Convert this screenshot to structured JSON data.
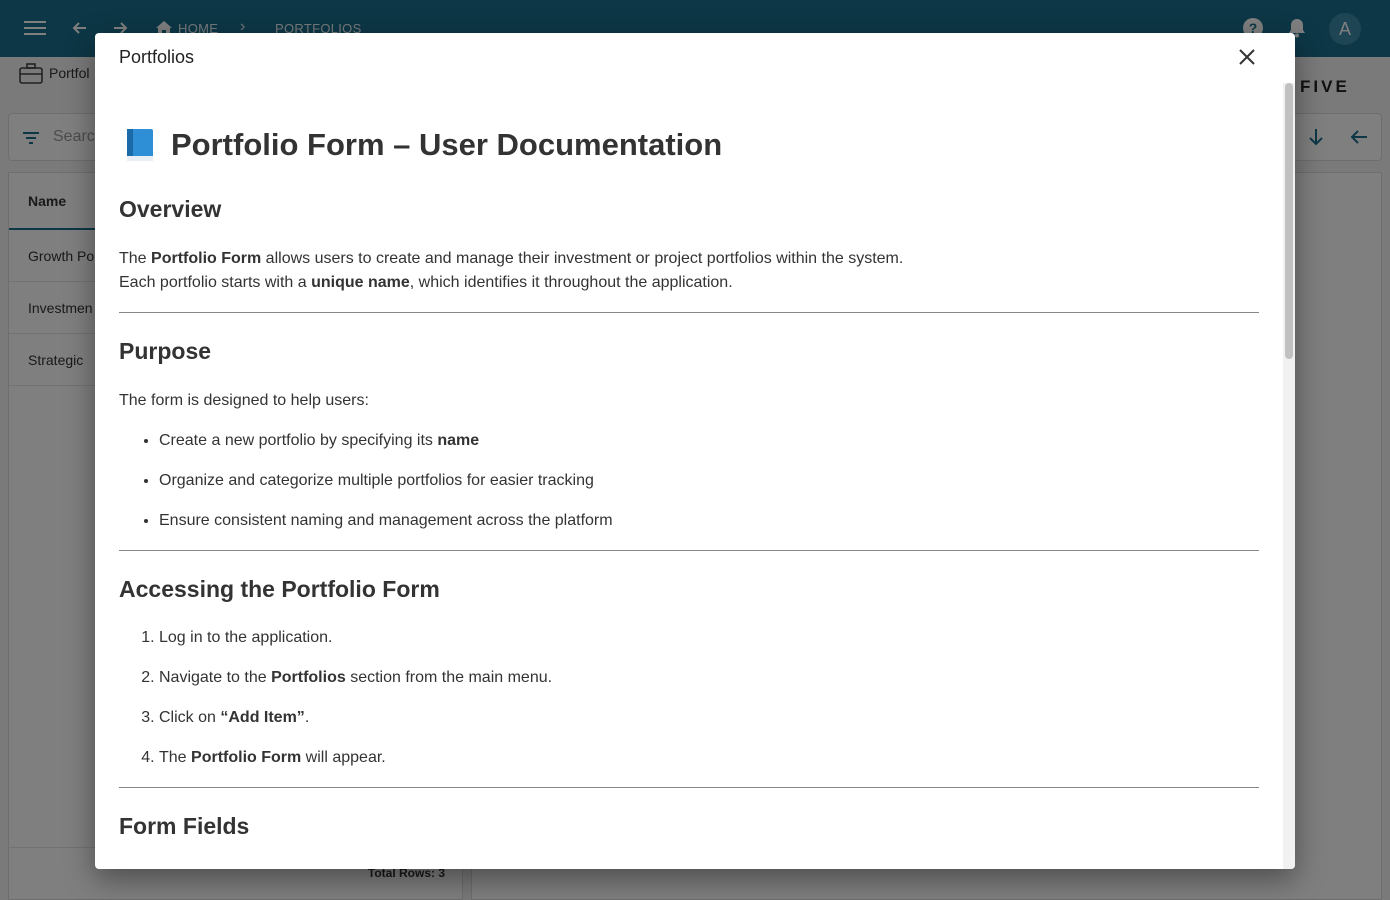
{
  "topbar": {
    "crumb_home": "HOME",
    "crumb_sep": "›",
    "crumb_portfolios": "PORTFOLIOS",
    "avatar_letter": "A",
    "color": "#1b6f8c"
  },
  "subbar": {
    "title": "Portfol",
    "logo": "FIVE"
  },
  "search": {
    "placeholder": "Search"
  },
  "list": {
    "header": "Name",
    "rows": [
      "Growth Po",
      "Investmen",
      "Strategic"
    ],
    "total": "Total Rows: 3"
  },
  "modal": {
    "title": "Portfolios",
    "doc": {
      "h1": "Portfolio Form – User Documentation",
      "overview": {
        "heading": "Overview",
        "line1": [
          "The ",
          "Portfolio Form",
          " allows users to create and manage their investment or project portfolios within the system."
        ],
        "line2": [
          "Each portfolio starts with a ",
          "unique name",
          ", which identifies it throughout the application."
        ]
      },
      "purpose": {
        "heading": "Purpose",
        "intro": "The form is designed to help users:",
        "items": [
          [
            "Create a new portfolio by specifying its ",
            "name",
            ""
          ],
          [
            "Organize and categorize multiple portfolios for easier tracking",
            "",
            ""
          ],
          [
            "Ensure consistent naming and management across the platform",
            "",
            ""
          ]
        ]
      },
      "accessing": {
        "heading": "Accessing the Portfolio Form",
        "steps": [
          [
            "Log in to the application.",
            "",
            ""
          ],
          [
            "Navigate to the ",
            "Portfolios",
            " section from the main menu."
          ],
          [
            "Click on ",
            "“Add Item”",
            "."
          ],
          [
            "The ",
            "Portfolio Form",
            " will appear."
          ]
        ]
      },
      "fields": {
        "heading": "Form Fields"
      }
    }
  }
}
